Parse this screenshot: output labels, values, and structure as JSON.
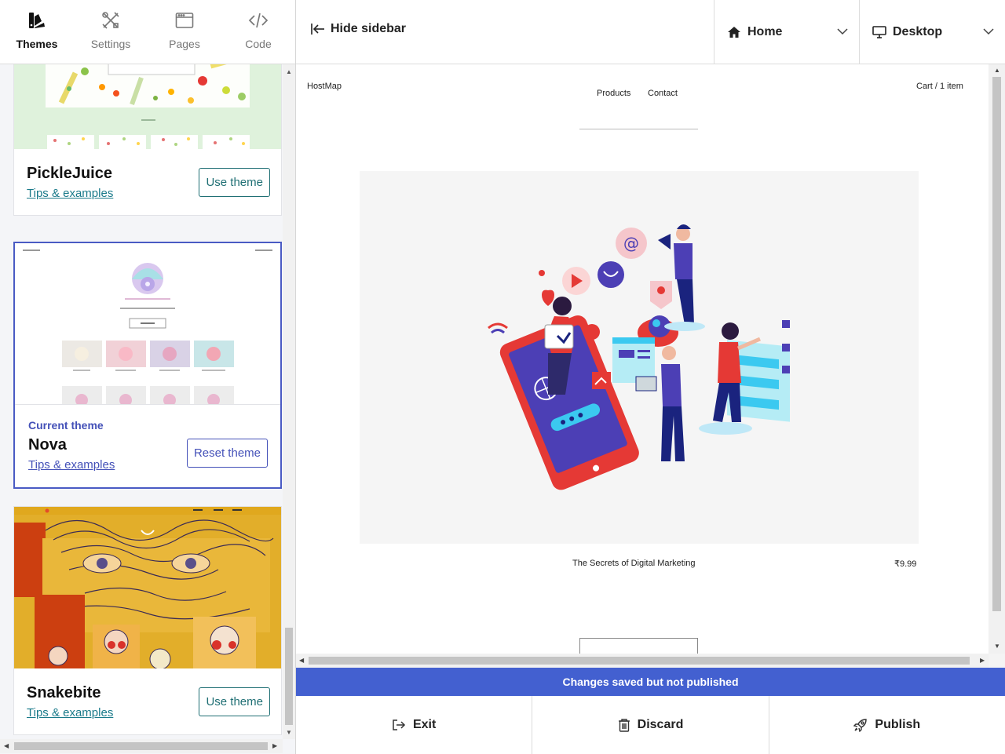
{
  "sidebar": {
    "tabs": [
      {
        "label": "Themes",
        "icon": "themes-icon",
        "active": true
      },
      {
        "label": "Settings",
        "icon": "settings-icon",
        "active": false
      },
      {
        "label": "Pages",
        "icon": "pages-icon",
        "active": false
      },
      {
        "label": "Code",
        "icon": "code-icon",
        "active": false
      }
    ],
    "themes": [
      {
        "name": "PickleJuice",
        "tips": "Tips & examples",
        "button": "Use theme"
      },
      {
        "name": "Nova",
        "tips": "Tips & examples",
        "button": "Reset theme",
        "current_label": "Current theme"
      },
      {
        "name": "Snakebite",
        "tips": "Tips & examples",
        "button": "Use theme"
      }
    ]
  },
  "topbar": {
    "hide_sidebar": "Hide sidebar",
    "page_select": "Home",
    "device_select": "Desktop"
  },
  "store": {
    "logo": "HostMap",
    "nav": [
      "Products",
      "Contact"
    ],
    "cart": "Cart",
    "cart_count": "/ 1 item",
    "product_name": "The Secrets of Digital Marketing",
    "product_price": "₹9.99"
  },
  "status": "Changes saved but not published",
  "actions": {
    "exit": "Exit",
    "discard": "Discard",
    "publish": "Publish"
  },
  "colors": {
    "accent": "#4360d0",
    "theme_button": "#1f6f74",
    "current_theme": "#4451b8"
  }
}
